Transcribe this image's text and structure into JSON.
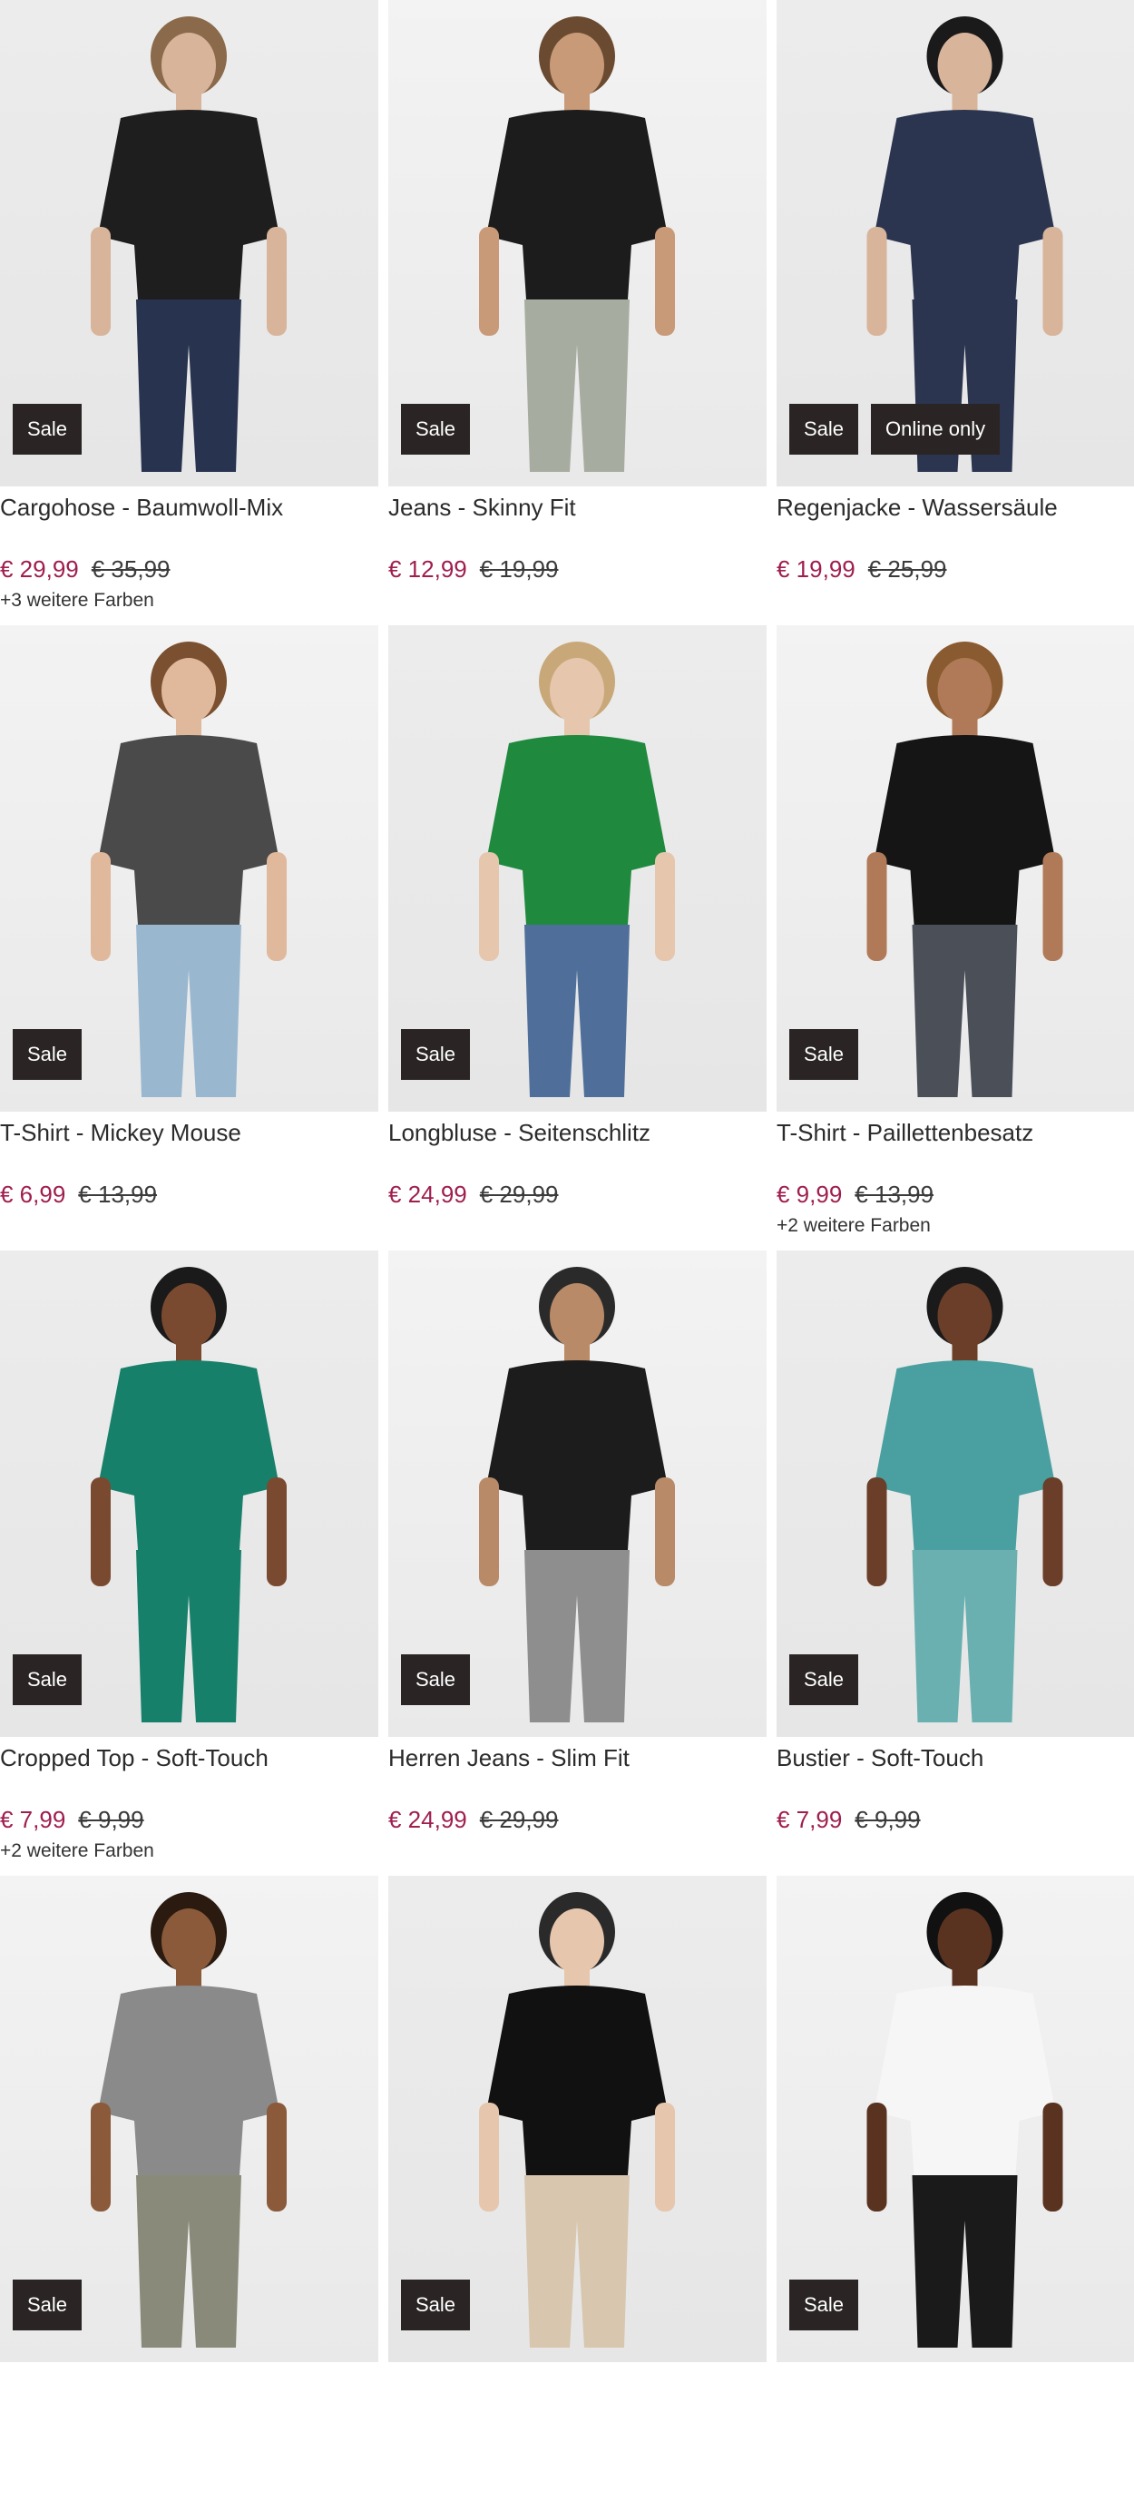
{
  "products": [
    {
      "name": "Cargohose - Baumwoll-Mix",
      "sale_price": "€ 29,99",
      "old_price": "€ 35,99",
      "colors": "+3 weitere Farben",
      "badges": [
        "Sale"
      ],
      "top": "#1e1e1e",
      "bottom": "#28334f",
      "skin": "#d8b49a",
      "hair": "#8a6a4a"
    },
    {
      "name": "Jeans - Skinny Fit",
      "sale_price": "€ 12,99",
      "old_price": "€ 19,99",
      "colors": "",
      "badges": [
        "Sale"
      ],
      "top": "#1c1c1c",
      "bottom": "#a7aca0",
      "skin": "#c99a78",
      "hair": "#6a4a30"
    },
    {
      "name": "Regenjacke - Wassersäule",
      "sale_price": "€ 19,99",
      "old_price": "€ 25,99",
      "colors": "",
      "badges": [
        "Sale",
        "Online only"
      ],
      "top": "#2b3550",
      "bottom": "#2b3550",
      "skin": "#d8b49a",
      "hair": "#1a1a1a"
    },
    {
      "name": "T-Shirt - Mickey Mouse",
      "sale_price": "€ 6,99",
      "old_price": "€ 13,99",
      "colors": "",
      "badges": [
        "Sale"
      ],
      "top": "#4a4a4a",
      "bottom": "#9ab7d0",
      "skin": "#e0b89c",
      "hair": "#7a5030"
    },
    {
      "name": "Longbluse - Seitenschlitz",
      "sale_price": "€ 24,99",
      "old_price": "€ 29,99",
      "colors": "",
      "badges": [
        "Sale"
      ],
      "top": "#1f8a3e",
      "bottom": "#4f6f9a",
      "skin": "#e6c6ad",
      "hair": "#c8a878"
    },
    {
      "name": "T-Shirt - Paillettenbesatz",
      "sale_price": "€ 9,99",
      "old_price": "€ 13,99",
      "colors": "+2 weitere Farben",
      "badges": [
        "Sale"
      ],
      "top": "#151515",
      "bottom": "#4a4f58",
      "skin": "#b07a58",
      "hair": "#8a5a30"
    },
    {
      "name": "Cropped Top - Soft-Touch",
      "sale_price": "€ 7,99",
      "old_price": "€ 9,99",
      "colors": "+2 weitere Farben",
      "badges": [
        "Sale"
      ],
      "top": "#17806a",
      "bottom": "#17806a",
      "skin": "#7a4a30",
      "hair": "#1a1a1a"
    },
    {
      "name": "Herren Jeans - Slim Fit",
      "sale_price": "€ 24,99",
      "old_price": "€ 29,99",
      "colors": "",
      "badges": [
        "Sale"
      ],
      "top": "#1c1c1c",
      "bottom": "#8e8e8e",
      "skin": "#b88a68",
      "hair": "#2a2a2a"
    },
    {
      "name": "Bustier - Soft-Touch",
      "sale_price": "€ 7,99",
      "old_price": "€ 9,99",
      "colors": "",
      "badges": [
        "Sale"
      ],
      "top": "#4aa0a0",
      "bottom": "#6ab0b0",
      "skin": "#6a3e28",
      "hair": "#1a1a1a"
    },
    {
      "name": "",
      "sale_price": "",
      "old_price": "",
      "colors": "",
      "badges": [
        "Sale"
      ],
      "top": "#8a8a8a",
      "bottom": "#8a8a7a",
      "skin": "#8a5a3a",
      "hair": "#2a1a10"
    },
    {
      "name": "",
      "sale_price": "",
      "old_price": "",
      "colors": "",
      "badges": [
        "Sale"
      ],
      "top": "#111111",
      "bottom": "#d8c6ae",
      "skin": "#e6c6ad",
      "hair": "#2a2a2a"
    },
    {
      "name": "",
      "sale_price": "",
      "old_price": "",
      "colors": "",
      "badges": [
        "Sale"
      ],
      "top": "#f6f6f6",
      "bottom": "#1a1a1a",
      "skin": "#5a3220",
      "hair": "#111111"
    }
  ]
}
